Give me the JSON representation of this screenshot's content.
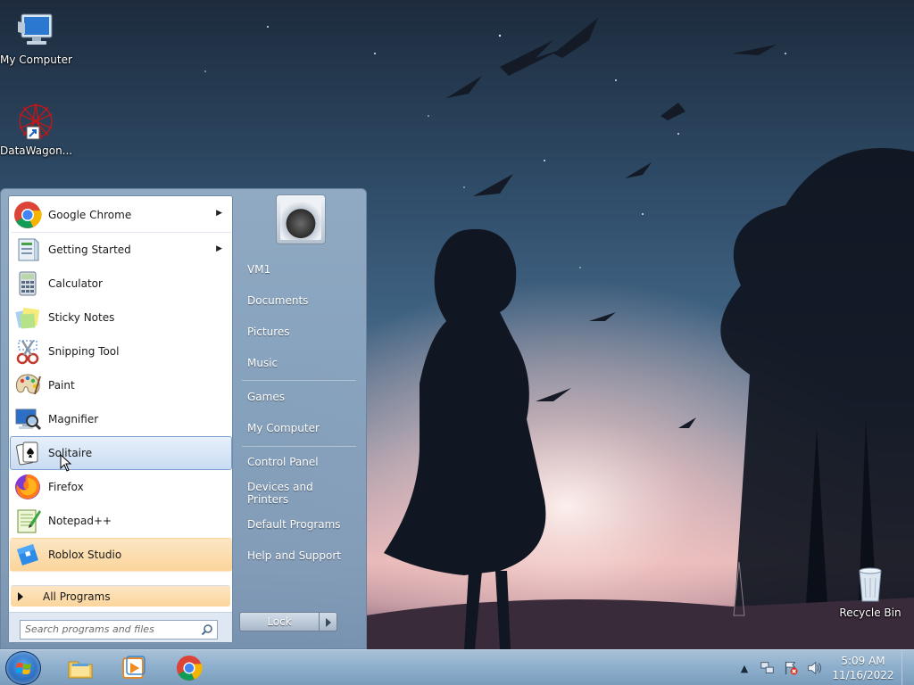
{
  "desktop": {
    "icons": [
      {
        "label": "My Computer",
        "icon": "computer-icon"
      },
      {
        "label": "DataWagon...",
        "icon": "datawagon-icon"
      },
      {
        "label": "Recycle Bin",
        "icon": "recycle-bin-icon"
      }
    ]
  },
  "start_menu": {
    "programs": [
      {
        "label": "Google Chrome",
        "icon": "chrome-icon",
        "has_submenu": true
      },
      {
        "label": "Getting Started",
        "icon": "getting-started-icon",
        "has_submenu": true
      },
      {
        "label": "Calculator",
        "icon": "calculator-icon"
      },
      {
        "label": "Sticky Notes",
        "icon": "sticky-notes-icon"
      },
      {
        "label": "Snipping Tool",
        "icon": "snipping-tool-icon"
      },
      {
        "label": "Paint",
        "icon": "paint-icon"
      },
      {
        "label": "Magnifier",
        "icon": "magnifier-icon"
      },
      {
        "label": "Solitaire",
        "icon": "solitaire-icon",
        "hovered": true
      },
      {
        "label": "Firefox",
        "icon": "firefox-icon"
      },
      {
        "label": "Notepad++",
        "icon": "notepadpp-icon"
      },
      {
        "label": "Roblox Studio",
        "icon": "roblox-studio-icon",
        "newly_installed": true
      }
    ],
    "all_programs": "All Programs",
    "search_placeholder": "Search programs and files",
    "right_links": {
      "user": "VM1",
      "documents": "Documents",
      "pictures": "Pictures",
      "music": "Music",
      "games": "Games",
      "computer": "My Computer",
      "control_panel": "Control Panel",
      "devices": "Devices and Printers",
      "defaults": "Default Programs",
      "help": "Help and Support"
    },
    "lock": "Lock"
  },
  "taskbar": {
    "pinned": [
      "explorer-icon",
      "media-player-icon",
      "chrome-icon"
    ],
    "clock_time": "5:09 AM",
    "clock_date": "11/16/2022",
    "tray_icons": [
      "show-hidden-icon",
      "network-icon",
      "action-center-icon",
      "volume-icon"
    ]
  }
}
